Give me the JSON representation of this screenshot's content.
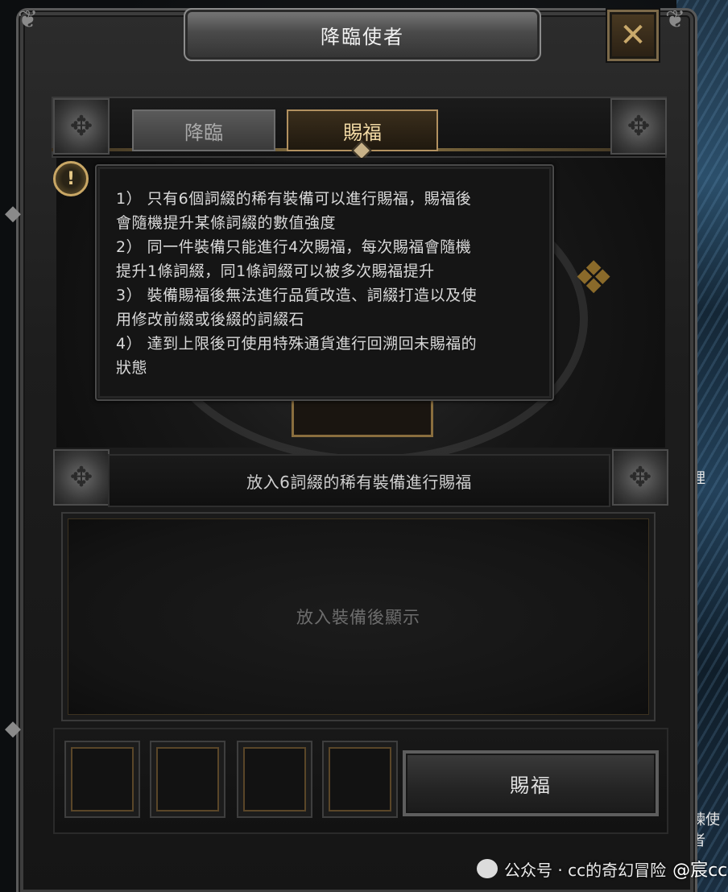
{
  "window": {
    "title": "降臨使者",
    "close_icon": "✕"
  },
  "tabs": [
    {
      "label": "降臨",
      "selected": false
    },
    {
      "label": "賜福",
      "selected": true
    }
  ],
  "info_icon": "!",
  "tooltip": {
    "lines": [
      "1） 只有6個詞綴的稀有裝備可以進行賜福，賜福後",
      "會隨機提升某條詞綴的數值強度",
      "2） 同一件裝備只能進行4次賜福，每次賜福會隨機",
      "提升1條詞綴，同1條詞綴可以被多次賜福提升",
      "3） 裝備賜福後無法進行品質改造、詞綴打造以及使",
      "用修改前綴或後綴的詞綴石",
      "4） 達到上限後可使用特殊通貨進行回溯回未賜福的",
      "狀態"
    ]
  },
  "instruction": "放入6詞綴的稀有裝備進行賜福",
  "display_placeholder": "放入裝備後顯示",
  "slots_count": 4,
  "action_button": "賜福",
  "background_fragments": {
    "right_top": "理",
    "right_bottom": "煉使者"
  },
  "watermark": {
    "text": "公众号 · cc的奇幻冒险",
    "handle": "@宸cc"
  },
  "colors": {
    "accent_gold": "#c9a765",
    "tab_selected_text": "#f1d9a4",
    "tab_inactive_text": "#a9a9a9",
    "tooltip_text": "#d9d9d9"
  }
}
